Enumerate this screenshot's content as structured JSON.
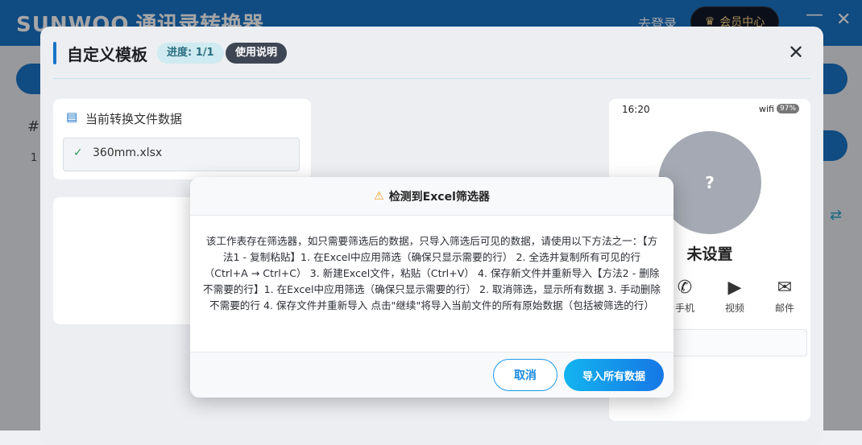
{
  "app": {
    "brand_en": "SUNWOO",
    "brand_cn": "通讯录转换器",
    "login_link": "去登录",
    "member_center": "会员中心",
    "min_glyph": "—",
    "close_glyph": "✕"
  },
  "background": {
    "table_hash": "#",
    "row_number": "1"
  },
  "template_modal": {
    "title": "自定义模板",
    "progress": "进度: 1/1",
    "help": "使用说明",
    "close_glyph": "✕",
    "file_section_title": "当前转换文件数据",
    "file_name": "360mm.xlsx"
  },
  "phone_preview": {
    "time": "16:20",
    "wifi": "wifi",
    "battery": "97%",
    "avatar_glyph": "?",
    "name": "未设置",
    "actions": [
      {
        "label": "手机",
        "icon": "phone-icon"
      },
      {
        "label": "视频",
        "icon": "video-icon"
      },
      {
        "label": "邮件",
        "icon": "mail-icon"
      }
    ]
  },
  "alert": {
    "title": "检测到Excel筛选器",
    "body": "该工作表存在筛选器，如只需要筛选后的数据，只导入筛选后可见的数据，请使用以下方法之一：【方法1 - 复制粘贴】1. 在Excel中应用筛选（确保只显示需要的行） 2. 全选并复制所有可见的行（Ctrl+A → Ctrl+C） 3. 新建Excel文件，粘贴（Ctrl+V） 4. 保存新文件并重新导入【方法2 - 删除不需要的行】1. 在Excel中应用筛选（确保只显示需要的行） 2. 取消筛选，显示所有数据 3. 手动删除不需要的行 4. 保存文件并重新导入 点击\"继续\"将导入当前文件的所有原始数据（包括被筛选的行）",
    "cancel_label": "取消",
    "import_label": "导入所有数据"
  }
}
